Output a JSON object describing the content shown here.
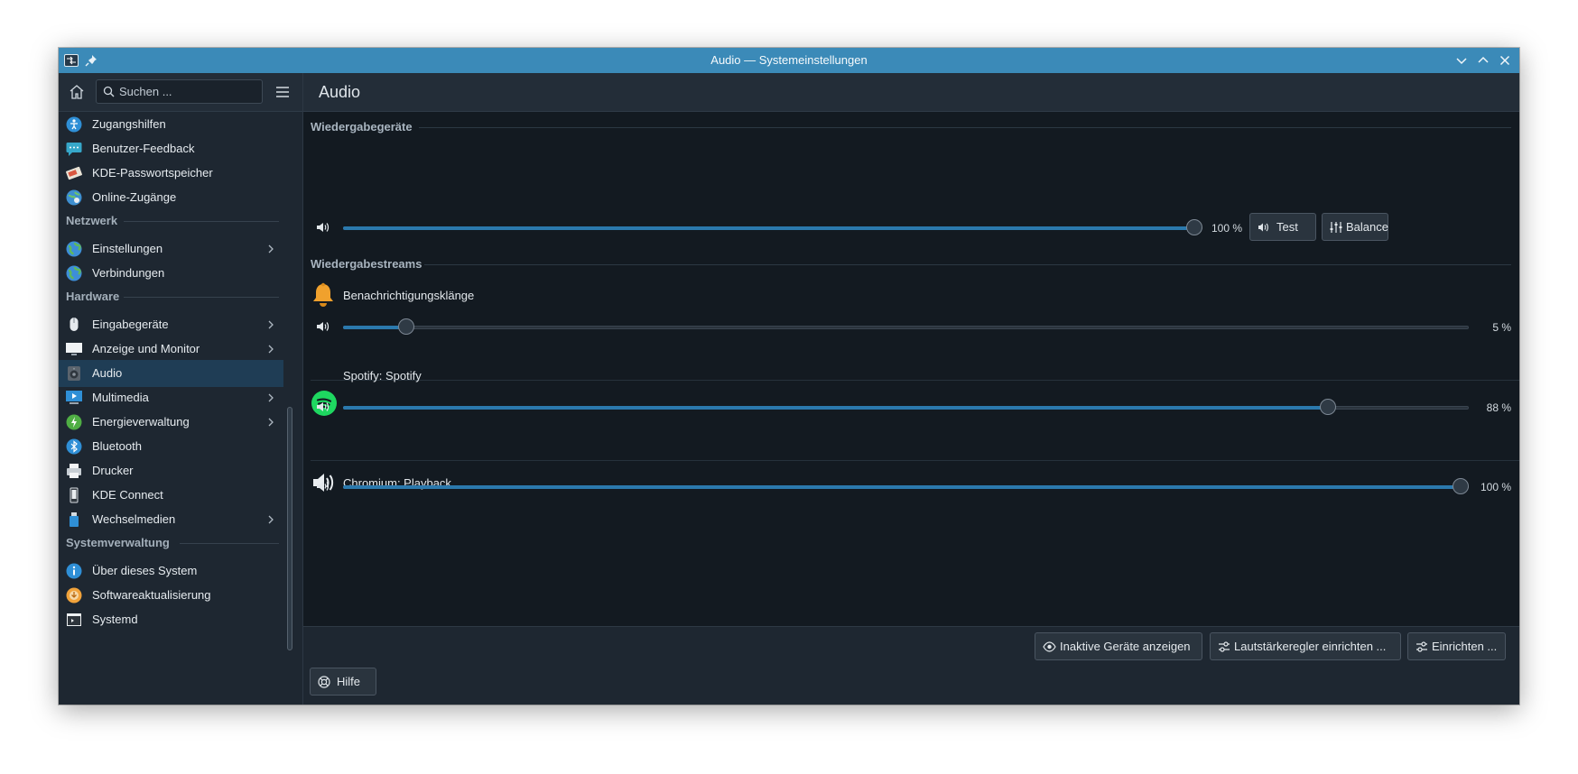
{
  "window": {
    "title": "Audio — Systemeinstellungen"
  },
  "sidebar": {
    "search_placeholder": "Suchen ...",
    "items_top": [
      {
        "label": "Zugangshilfen",
        "icon": "accessibility-icon"
      },
      {
        "label": "Benutzer-Feedback",
        "icon": "feedback-icon"
      },
      {
        "label": "KDE-Passwortspeicher",
        "icon": "wallet-icon"
      },
      {
        "label": "Online-Zugänge",
        "icon": "online-accounts-icon"
      }
    ],
    "sections": {
      "netzwerk": "Netzwerk",
      "hardware": "Hardware",
      "systemverwaltung": "Systemverwaltung"
    },
    "network_items": [
      {
        "label": "Einstellungen",
        "icon": "globe-icon",
        "has_children": true
      },
      {
        "label": "Verbindungen",
        "icon": "globe-icon",
        "has_children": false
      }
    ],
    "hardware_items": [
      {
        "label": "Eingabegeräte",
        "icon": "mouse-icon",
        "has_children": true
      },
      {
        "label": "Anzeige und Monitor",
        "icon": "monitor-icon",
        "has_children": true
      },
      {
        "label": "Audio",
        "icon": "speaker-icon",
        "has_children": false,
        "active": true
      },
      {
        "label": "Multimedia",
        "icon": "multimedia-icon",
        "has_children": true
      },
      {
        "label": "Energieverwaltung",
        "icon": "power-icon",
        "has_children": true
      },
      {
        "label": "Bluetooth",
        "icon": "bluetooth-icon",
        "has_children": false
      },
      {
        "label": "Drucker",
        "icon": "printer-icon",
        "has_children": false
      },
      {
        "label": "KDE Connect",
        "icon": "phone-icon",
        "has_children": false
      },
      {
        "label": "Wechselmedien",
        "icon": "usb-icon",
        "has_children": true
      }
    ],
    "system_items": [
      {
        "label": "Über dieses System",
        "icon": "info-icon"
      },
      {
        "label": "Softwareaktualisierung",
        "icon": "update-icon"
      },
      {
        "label": "Systemd",
        "icon": "systemd-icon"
      }
    ]
  },
  "main": {
    "title": "Audio",
    "playback_devices": {
      "heading": "Wiedergabegeräte",
      "volume_percent": 100,
      "volume_label": "100 %",
      "test_label": "Test",
      "balance_label": "Balance"
    },
    "playback_streams": {
      "heading": "Wiedergabestreams",
      "streams": [
        {
          "name": "Benachrichtigungsklänge",
          "icon": "bell-icon",
          "volume_percent": 5,
          "volume_label": "5 %"
        },
        {
          "name": "Spotify: Spotify",
          "icon": "spotify-icon",
          "volume_percent": 88,
          "volume_label": "88 %"
        },
        {
          "name": "Chromium: Playback",
          "icon": "speaker-icon",
          "volume_percent": 100,
          "volume_label": "100 %"
        }
      ]
    }
  },
  "footer": {
    "show_inactive_label": "Inaktive Geräte anzeigen",
    "configure_volume_label": "Lautstärkeregler einrichten ...",
    "configure_label": "Einrichten ...",
    "help_label": "Hilfe"
  },
  "colors": {
    "titlebar": "#3b8ab8",
    "accent": "#2b79ad",
    "active_item": "#1f3d55"
  }
}
